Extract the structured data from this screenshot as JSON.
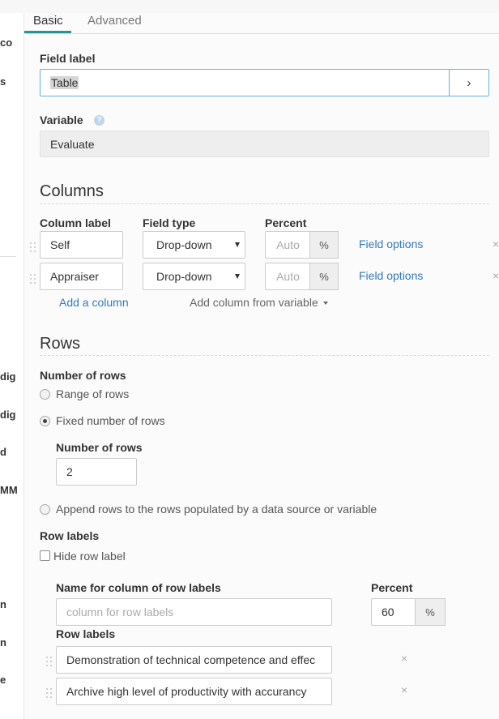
{
  "left_sidebar": {
    "fragments": [
      "co",
      "s",
      "dig",
      "dig",
      "d",
      "MM",
      "n",
      "n",
      "e"
    ]
  },
  "tabs": [
    {
      "label": "Basic",
      "active": true
    },
    {
      "label": "Advanced",
      "active": false
    }
  ],
  "field_label": {
    "label": "Field label",
    "value": "Table",
    "button_glyph": "›"
  },
  "variable": {
    "label": "Variable",
    "help_glyph": "?",
    "value": "Evaluate"
  },
  "columns": {
    "title": "Columns",
    "headers": {
      "column_label": "Column label",
      "field_type": "Field type",
      "percent": "Percent"
    },
    "rows": [
      {
        "label": "Self",
        "type": "Drop-down",
        "percent_placeholder": "Auto",
        "percent_suffix": "%",
        "options_link": "Field options",
        "remove": "×"
      },
      {
        "label": "Appraiser",
        "type": "Drop-down",
        "percent_placeholder": "Auto",
        "percent_suffix": "%",
        "options_link": "Field options",
        "remove": "×"
      }
    ],
    "add_column": "Add a column",
    "add_from_variable": "Add column from variable"
  },
  "rows": {
    "title": "Rows",
    "number_of_rows_label": "Number of rows",
    "options": [
      {
        "label": "Range of rows",
        "checked": false
      },
      {
        "label": "Fixed number of rows",
        "checked": true
      }
    ],
    "fixed_count_label": "Number of rows",
    "fixed_count_value": "2",
    "append_option": {
      "label": "Append rows to the rows populated by a data source or variable",
      "checked": false
    },
    "row_labels_heading": "Row labels",
    "hide_row_label": {
      "label": "Hide row label",
      "checked": false
    },
    "name_column_label": "Name for column of row labels",
    "name_column_placeholder": "column for row labels",
    "percent_label": "Percent",
    "percent_value": "60",
    "percent_suffix": "%",
    "row_labels_sublabel": "Row labels",
    "labels": [
      {
        "value": "Demonstration of technical competence and effec",
        "remove": "×"
      },
      {
        "value": "Archive high level of productivity with accurancy",
        "remove": "×"
      }
    ]
  }
}
